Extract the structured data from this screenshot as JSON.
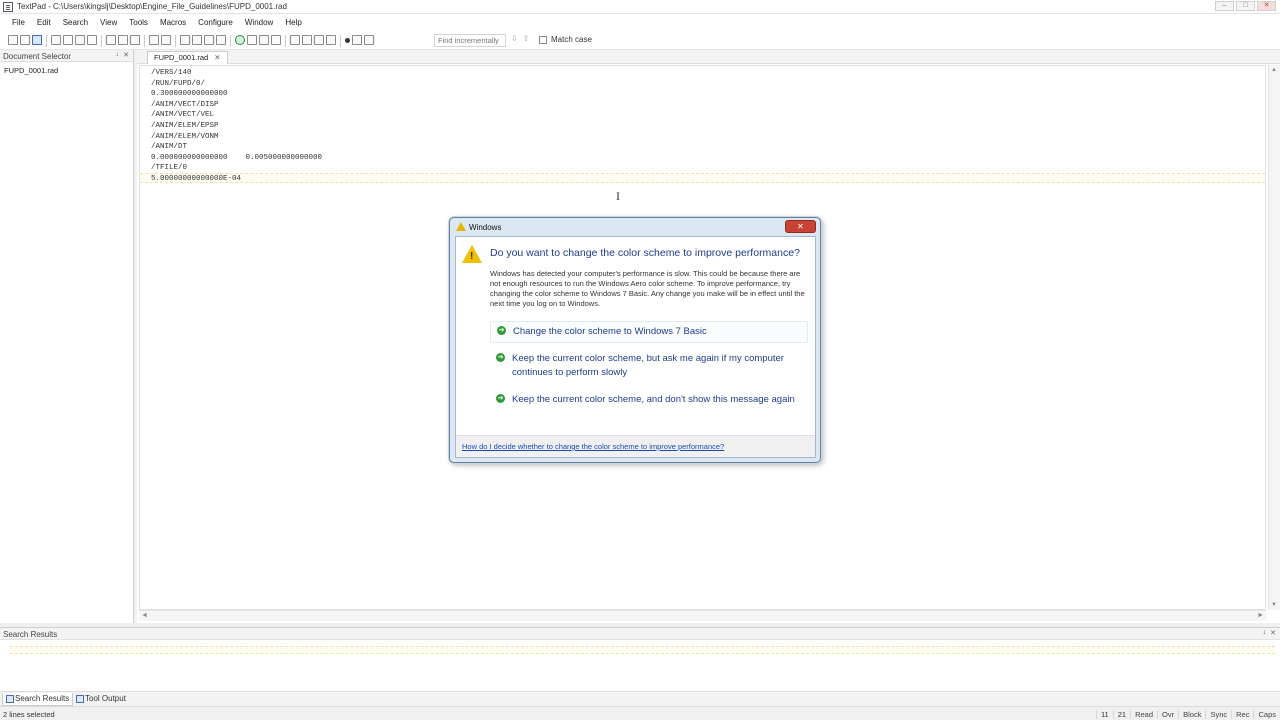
{
  "window": {
    "title": "TextPad - C:\\Users\\kingslj\\Desktop\\Engine_File_Guidelines\\FUPD_0001.rad",
    "buttons": [
      "–",
      "□",
      "✕"
    ]
  },
  "menu": {
    "items": [
      "File",
      "Edit",
      "Search",
      "View",
      "Tools",
      "Macros",
      "Configure",
      "Window",
      "Help"
    ]
  },
  "toolbar": {
    "find_placeholder": "Find incrementally",
    "find_arrows": "⇩⇧",
    "match_case_label": "Match case"
  },
  "document_selector": {
    "title": "Document Selector",
    "pin": "↓",
    "close": "✕",
    "items": [
      "FUPD_0001.rad"
    ]
  },
  "editor": {
    "tab_label": "FUPD_0001.rad",
    "tab_close": "✕",
    "lines": [
      "/VERS/140",
      "/RUN/FUPD/0/",
      "0.300000000000000",
      "/ANIM/VECT/DISP",
      "/ANIM/VECT/VEL",
      "/ANIM/ELEM/EPSP",
      "/ANIM/ELEM/VONM",
      "/ANIM/DT",
      "0.000000000000000    0.005000000000000",
      "/TFILE/0",
      "5.00000000000000E-04"
    ],
    "scroll_up": "▲",
    "scroll_down": "▼",
    "scroll_left": "◄",
    "scroll_right": "►"
  },
  "dialog": {
    "title": "Windows",
    "close": "✕",
    "heading": "Do you want to change the color scheme to improve performance?",
    "description": "Windows has detected your computer's performance is slow. This could be because there are not enough resources to run the Windows Aero color scheme. To improve performance, try changing the color scheme to Windows 7 Basic. Any change you make will be in effect until the next time you log on to Windows.",
    "options": [
      "Change the color scheme to Windows 7 Basic",
      "Keep the current color scheme, but ask me again if my computer continues to perform slowly",
      "Keep the current color scheme, and don't show this message again"
    ],
    "option_arrow": "➔",
    "footer_link": "How do I decide whether to change the color scheme to improve performance?"
  },
  "search_results": {
    "title": "Search Results",
    "pin": "↓",
    "close": "✕"
  },
  "bottom_tabs": [
    "Search Results",
    "Tool Output"
  ],
  "statusbar": {
    "text": "2 lines selected",
    "indicators": [
      "11",
      "21",
      "Read",
      "Ovr",
      "Block",
      "Sync",
      "Rec",
      "Caps"
    ]
  },
  "colors": {
    "dialog_heading": "#1e3c8c",
    "dialog_close": "#c94335",
    "link": "#1a4ab8",
    "current_line": "#fffdf2"
  }
}
